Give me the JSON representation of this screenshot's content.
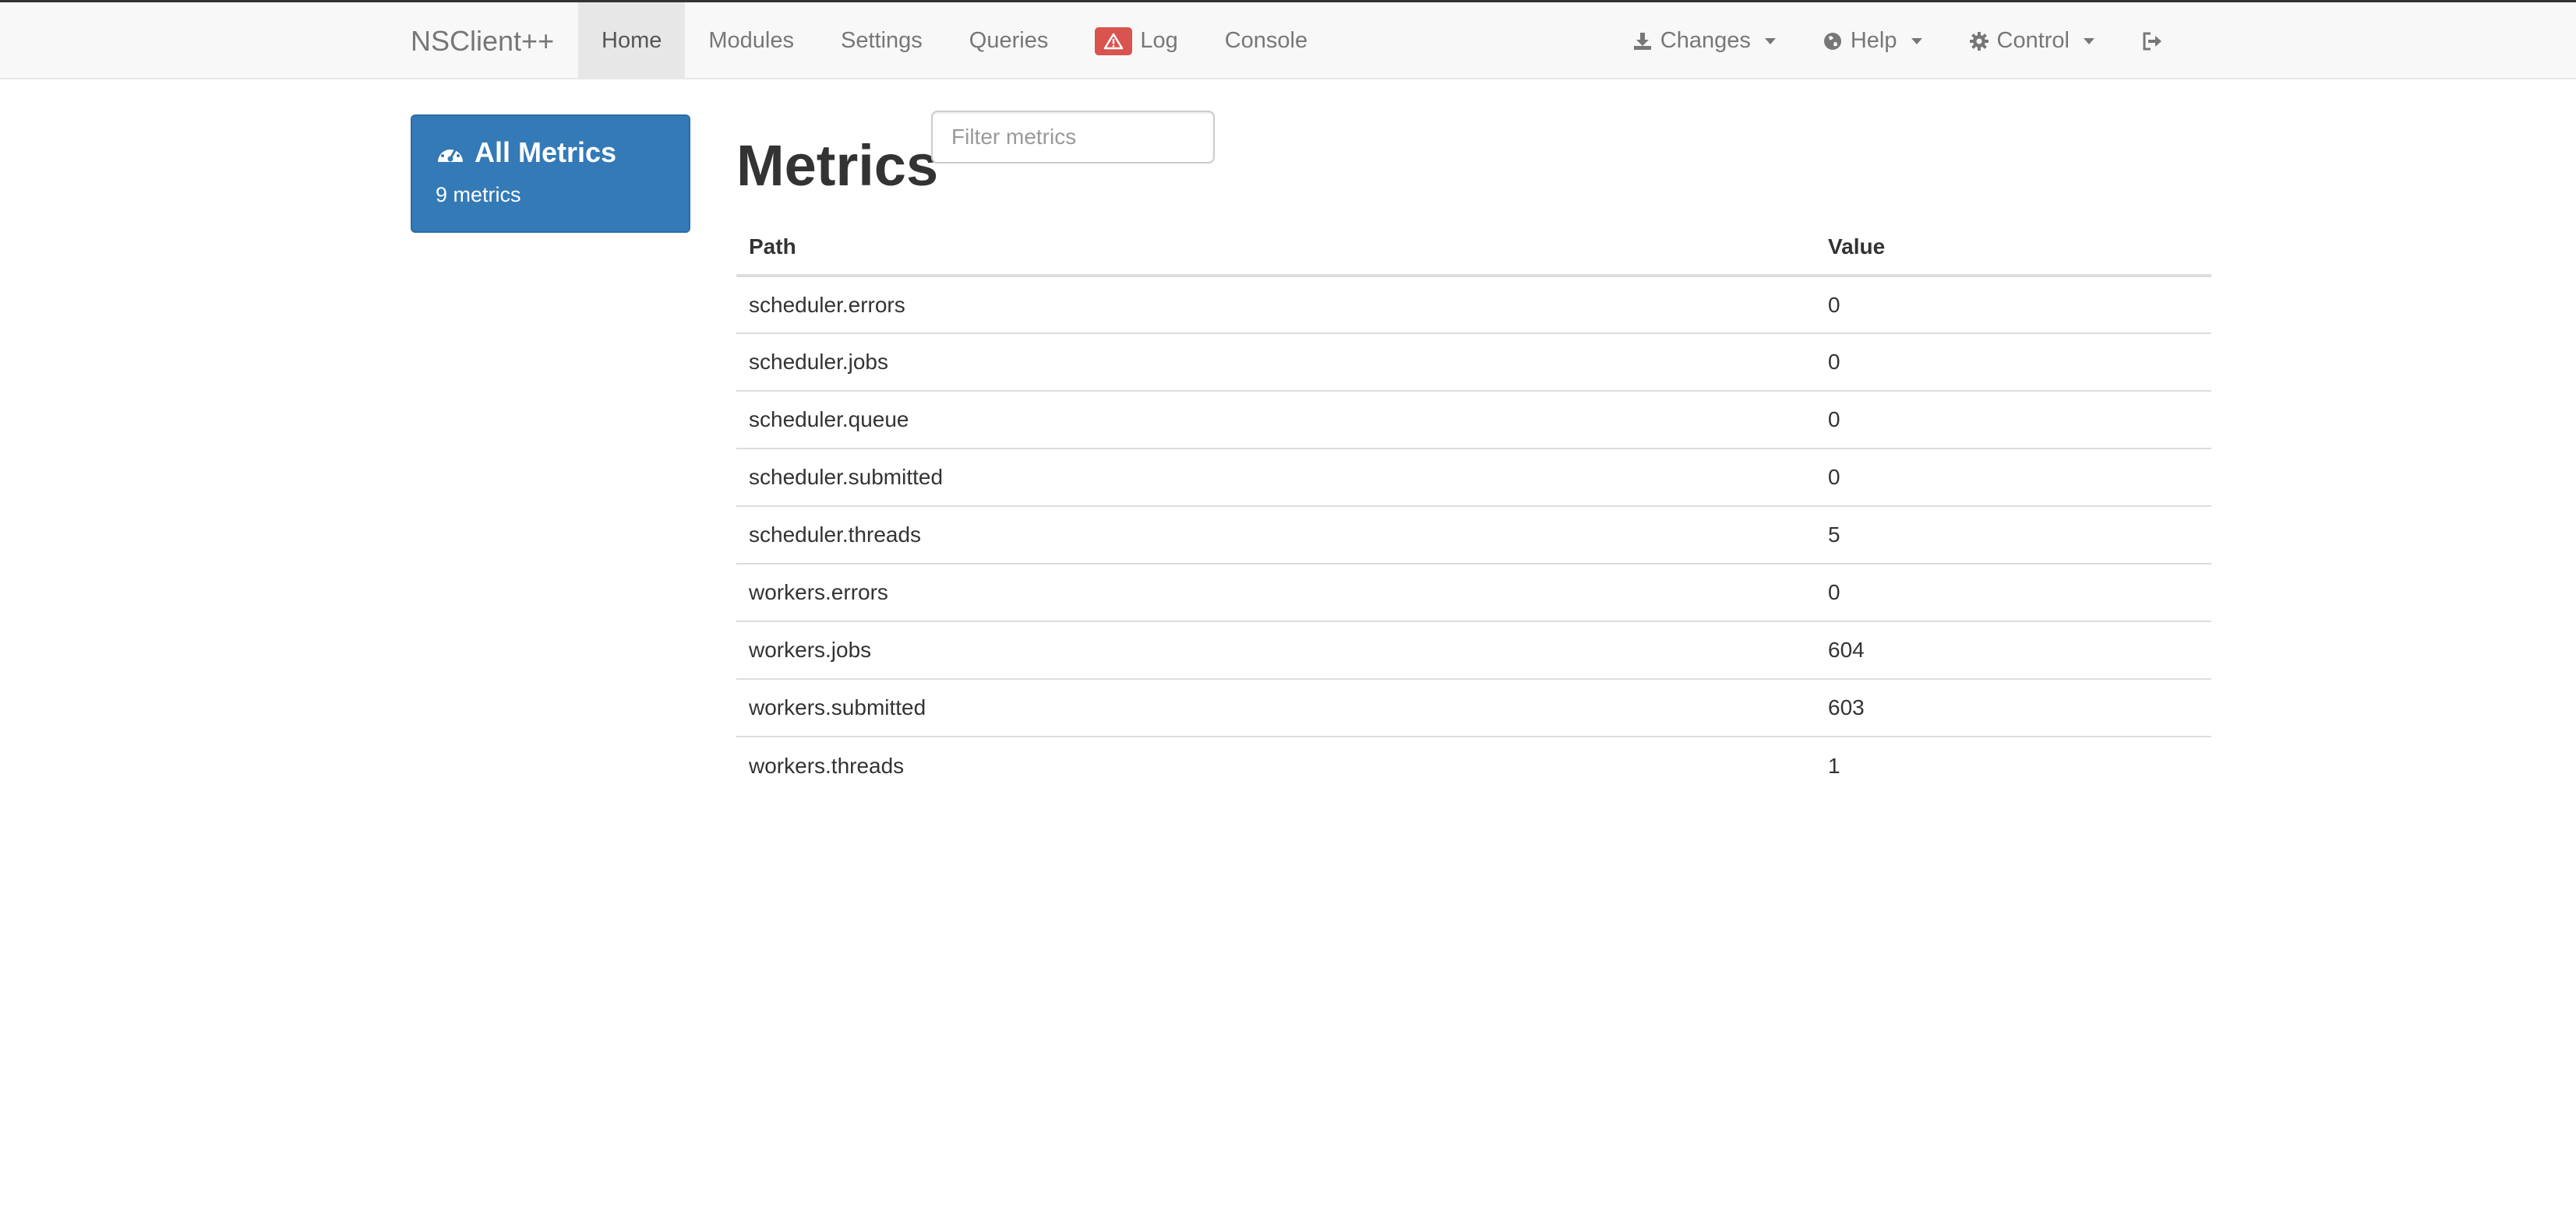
{
  "navbar": {
    "brand": "NSClient++",
    "left_items": [
      {
        "label": "Home",
        "active": true
      },
      {
        "label": "Modules"
      },
      {
        "label": "Settings"
      },
      {
        "label": "Queries"
      },
      {
        "label": "Log",
        "badge_icon": "warning-icon"
      },
      {
        "label": "Console"
      }
    ],
    "right_items": [
      {
        "label": "Changes",
        "icon": "download-icon"
      },
      {
        "label": "Help",
        "icon": "globe-icon"
      },
      {
        "label": "Control",
        "icon": "gear-icon"
      },
      {
        "icon": "logout-icon"
      }
    ]
  },
  "sidebar": {
    "title": "All Metrics",
    "icon": "dashboard-icon",
    "subtitle": "9 metrics"
  },
  "filter": {
    "placeholder": "Filter metrics",
    "value": ""
  },
  "main": {
    "title": "Metrics",
    "columns": [
      "Path",
      "Value"
    ],
    "rows": [
      [
        "scheduler.errors",
        "0"
      ],
      [
        "scheduler.jobs",
        "0"
      ],
      [
        "scheduler.queue",
        "0"
      ],
      [
        "scheduler.submitted",
        "0"
      ],
      [
        "scheduler.threads",
        "5"
      ],
      [
        "workers.errors",
        "0"
      ],
      [
        "workers.jobs",
        "604"
      ],
      [
        "workers.submitted",
        "603"
      ],
      [
        "workers.threads",
        "1"
      ]
    ]
  },
  "colors": {
    "navbar_bg": "#f8f8f8",
    "active_bg": "#e7e7e7",
    "primary": "#337ab7",
    "danger": "#d9534f"
  }
}
